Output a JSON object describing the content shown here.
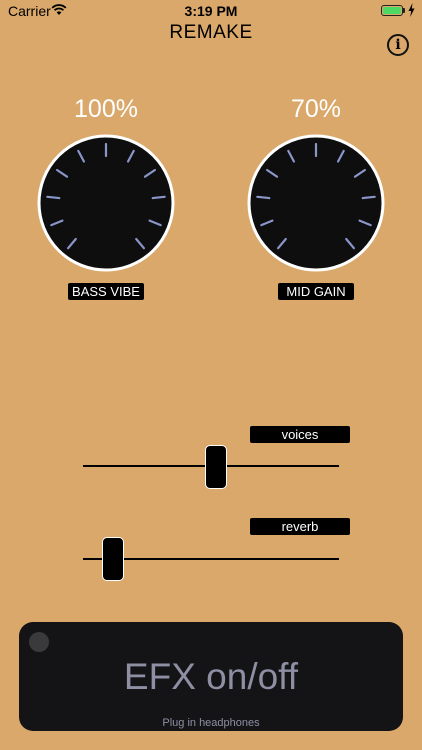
{
  "status_bar": {
    "carrier": "Carrier",
    "time": "3:19 PM"
  },
  "header": {
    "title": "REMAKE",
    "info_glyph": "i"
  },
  "knobs": [
    {
      "label": "BASS VIBE",
      "value_text": "100%",
      "level": 1.0
    },
    {
      "label": "MID GAIN",
      "value_text": "70%",
      "level": 0.7
    }
  ],
  "sliders": [
    {
      "label": "voices",
      "level": 0.52
    },
    {
      "label": "reverb",
      "level": 0.08
    }
  ],
  "efx": {
    "label": "EFX on/off",
    "hint": "Plug in headphones"
  },
  "colors": {
    "background": "#d9a86a",
    "tick": "#8a95c8",
    "efx_text": "#8e8fa3",
    "battery": "#4cd964"
  }
}
